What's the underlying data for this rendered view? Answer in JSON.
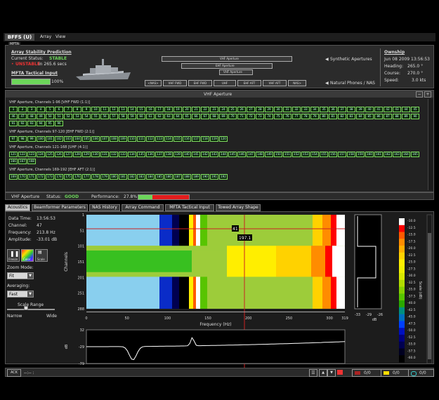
{
  "titlebar": {
    "title": "BFFS (U)",
    "menu": [
      "Array",
      "View"
    ]
  },
  "mfta": {
    "group_label": "MFTA",
    "stability_title": "Array Stability Prediction",
    "status_label": "Current Status:",
    "status_value": "STABLE",
    "unstable_label": "UNSTABLE",
    "unstable_suffix": "in 265.6 secs",
    "tactical_title": "MFTA Tactical Input",
    "tactical_pct": "100%",
    "apertures": [
      "VHF Aperture",
      "EHF Aperture",
      "VHF Aperture"
    ],
    "synthetic_label": "Synthetic Apertures",
    "natural_label": "Natural Phones / NAS",
    "natural_buttons": [
      "<NAS>",
      "VHF FWD",
      "EHF FWD",
      "UHF",
      "EHF AFT",
      "VHF AFT",
      "NAS>"
    ]
  },
  "ownship": {
    "title": "Ownship",
    "datetime": "Jun 08 2009 13:56:53",
    "heading_label": "Heading:",
    "heading_value": "265.0 °",
    "course_label": "Course:",
    "course_value": "270.0 °",
    "speed_label": "Speed:",
    "speed_value": "3.0 kts"
  },
  "vhf_panel": {
    "title": "VHF Aperture",
    "groups": [
      {
        "label": "VHF Aperture, Channels 1-96 [VHF FWD (1:1)]",
        "start": 1,
        "end": 96
      },
      {
        "label": "VHF Aperture, Channels 97-120 [EHF FWD (2:1)]",
        "start": 97,
        "end": 120
      },
      {
        "label": "VHF Aperture, Channels 121-168 [UHF (4:1)]",
        "start": 121,
        "end": 168
      },
      {
        "label": "VHF Aperture, Channels 169-192 [EHF AFT (2:1)]",
        "start": 169,
        "end": 192
      }
    ],
    "status_name": "VHF Aperture",
    "status_label": "Status:",
    "status_value": "GOOD",
    "performance_label": "Performance:",
    "performance_value": "27.8%",
    "performance_fraction": 0.278
  },
  "tabs": [
    "Acoustics",
    "Beamformer Parameters",
    "NAS History",
    "Array Command",
    "MFTA Tactical Input",
    "Towed Array Shape"
  ],
  "acoustics": {
    "data_time_label": "Data Time:",
    "data_time": "13:56:53",
    "channel_label": "Channel:",
    "channel": "47",
    "frequency_label": "Frequency:",
    "frequency": "213.8 Hz",
    "amplitude_label": "Amplitude:",
    "amplitude": "-33.01 dB",
    "buttons": [
      "Freeze",
      "Color",
      "Scale"
    ],
    "zoom_label": "Zoom Mode:",
    "zoom_value": "Fit",
    "averaging_label": "Averaging:",
    "averaging_value": "Fast",
    "scale_range_label": "Scale Range",
    "narrow": "Narrow",
    "wide": "Wide",
    "cursor_channel_tag": "41",
    "cursor_freq_tag": "197.1",
    "ylabel": "Channels",
    "xlabel": "Frequency (Hz)",
    "y_ticks": [
      "1",
      "51",
      "101",
      "151",
      "201",
      "251",
      "288"
    ],
    "x_ticks": [
      "0",
      "50",
      "100",
      "150",
      "200",
      "250",
      "300",
      "319"
    ],
    "db_axis_label": "dB",
    "db_ticks": [
      "32",
      "-29",
      "-79"
    ],
    "side_ticks": [
      "-33",
      "-29",
      "-26"
    ],
    "side_label": "dB",
    "scale_title": "Scale (dB)",
    "scale_ticks": [
      "-10.0",
      "-12.5",
      "-15.0",
      "-17.5",
      "-20.0",
      "-22.5",
      "-25.0",
      "-27.5",
      "-30.0",
      "-32.5",
      "-35.0",
      "-37.5",
      "-40.0",
      "-42.5",
      "-45.0",
      "-47.5",
      "-50.0",
      "-52.5",
      "-55.0",
      "-57.5",
      "-60.0"
    ],
    "scale_colors": [
      "#ffffff",
      "#ff0000",
      "#ff5a00",
      "#ff8c00",
      "#ffb000",
      "#ffd200",
      "#ffee00",
      "#f0f000",
      "#d8e800",
      "#b0dc00",
      "#86d000",
      "#58c400",
      "#2aa800",
      "#009080",
      "#0070c0",
      "#0040ff",
      "#0010c0",
      "#000080",
      "#000050",
      "#000020",
      "#000000"
    ]
  },
  "statusbar": {
    "ack": "ACK",
    "dashes": "--:-- :",
    "count1": "0/0",
    "count2": "0/0",
    "count3": "0/0"
  }
}
